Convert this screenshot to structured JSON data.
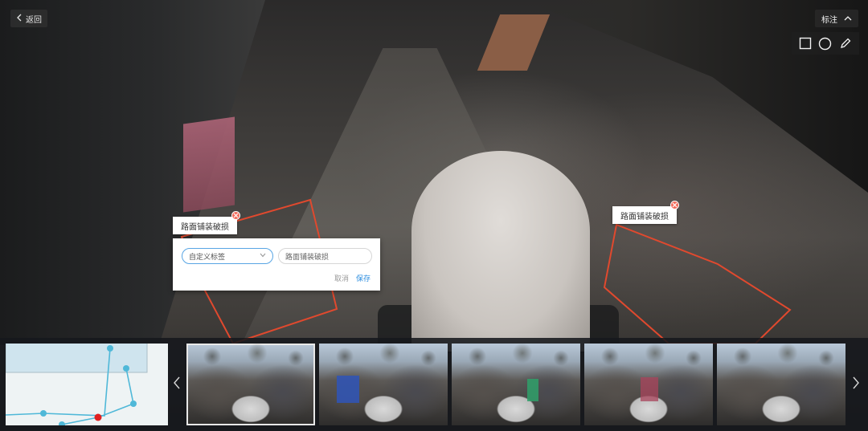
{
  "toolbar": {
    "back_label": "返回",
    "mark_label": "标注"
  },
  "tools": [
    "rectangle-tool",
    "circle-tool",
    "pen-tool"
  ],
  "annotations": [
    {
      "label": "路面铺装破损"
    },
    {
      "label": "路面铺装破损"
    }
  ],
  "edit_popup": {
    "category_placeholder": "自定义标签",
    "name_value": "路面铺装破损",
    "cancel_label": "取消",
    "save_label": "保存"
  },
  "filmstrip": {
    "thumbnail_count": 6,
    "selected_index": 0
  },
  "colors": {
    "annotation_stroke": "#e0492e",
    "close_badge": "#f26b5b",
    "route_line": "#4fb8d8",
    "current_position": "#e02020",
    "save_link": "#2f8fe0",
    "select_border": "#58a5e4"
  }
}
